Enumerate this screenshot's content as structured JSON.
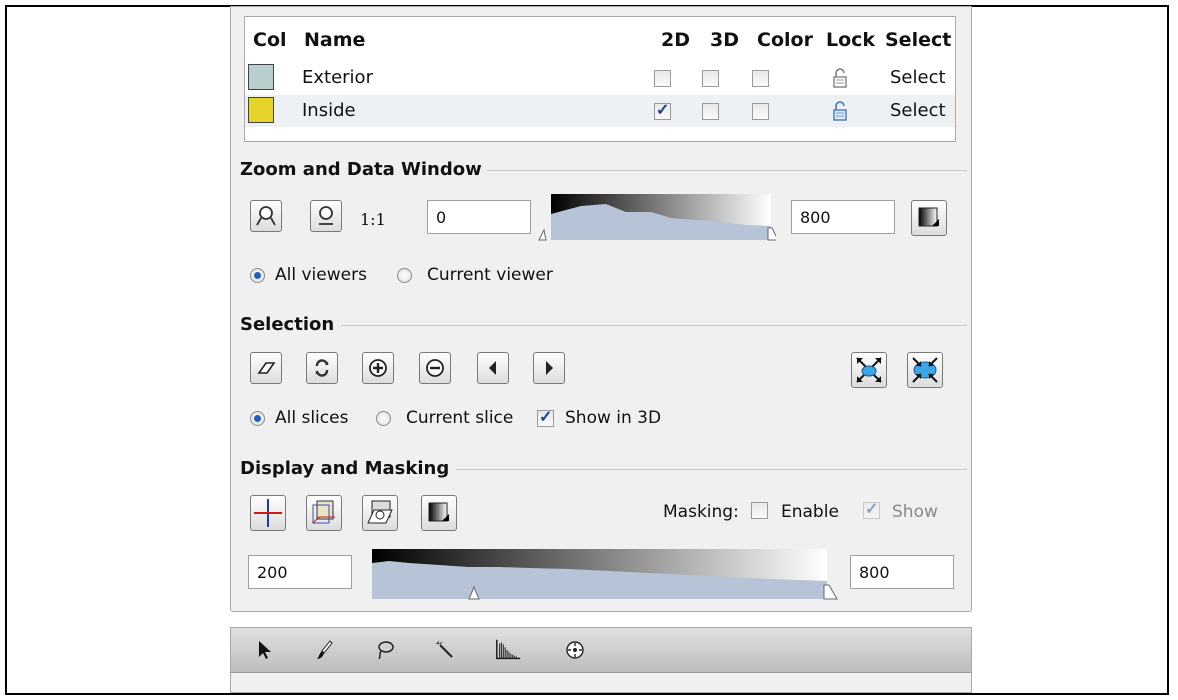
{
  "labels_table": {
    "headers": {
      "col": "Col",
      "name": "Name",
      "d2": "2D",
      "d3": "3D",
      "color": "Color",
      "lock": "Lock",
      "select": "Select"
    },
    "rows": [
      {
        "color": "#b9cfcf",
        "name": "Exterior",
        "d2": false,
        "d3": false,
        "color_check": false,
        "locked": false,
        "select": "Select"
      },
      {
        "color": "#e5d22a",
        "name": "Inside",
        "d2": true,
        "d3": false,
        "color_check": false,
        "locked": false,
        "select": "Select"
      }
    ]
  },
  "zoom": {
    "title": "Zoom and Data Window",
    "ratio_label": "1:1",
    "min_value": "0",
    "max_value": "800",
    "all_viewers": "All viewers",
    "current_viewer": "Current viewer",
    "selected": "all_viewers"
  },
  "selection": {
    "title": "Selection",
    "all_slices": "All slices",
    "current_slice": "Current slice",
    "show_in_3d": "Show in 3D",
    "show_in_3d_checked": true,
    "selected": "all_slices"
  },
  "display": {
    "title": "Display and Masking",
    "masking_label": "Masking:",
    "enable_label": "Enable",
    "show_label": "Show",
    "enable_checked": false,
    "show_checked": true,
    "min_value": "200",
    "max_value": "800"
  },
  "toolbar": {
    "tools": [
      "pointer-tool",
      "brush-tool",
      "lasso-tool",
      "magic-wand-tool",
      "histogram-tool",
      "target-tool"
    ]
  }
}
